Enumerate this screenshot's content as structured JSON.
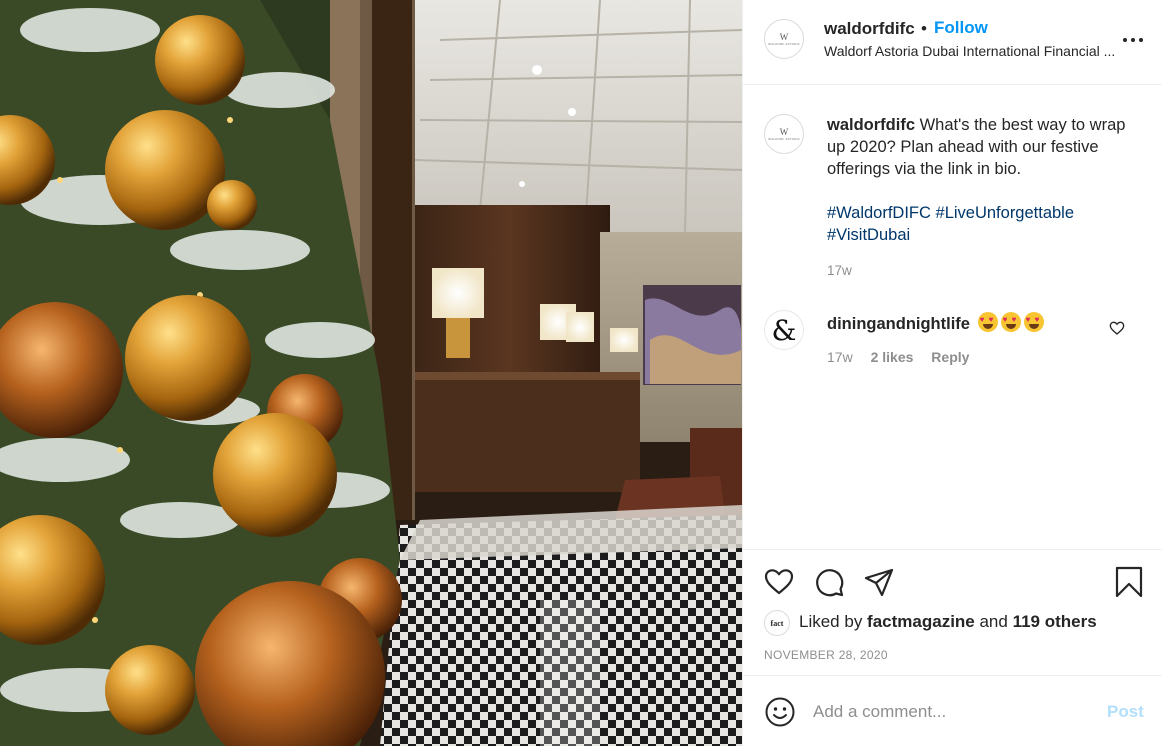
{
  "header": {
    "username": "waldorfdifc",
    "separator": "•",
    "follow_label": "Follow",
    "location": "Waldorf Astoria Dubai International Financial ..."
  },
  "avatar": {
    "mark": "W",
    "sub": "WALDORF ASTORIA"
  },
  "caption": {
    "username": "waldorfdifc",
    "text": " What's the best way to wrap up 2020? Plan ahead with our festive offerings via the link in bio.",
    "hashtags": [
      "#WaldorfDIFC",
      "#LiveUnforgettable",
      "#VisitDubai"
    ],
    "time": "17w"
  },
  "comment": {
    "avatar_glyph": "&",
    "username": "diningandnightlife",
    "emoji_name": "heart-eyes-emoji",
    "time": "17w",
    "likes": "2 likes",
    "reply_label": "Reply"
  },
  "likes": {
    "avatar_text": "fact",
    "prefix": "Liked by ",
    "user": "factmagazine",
    "middle": " and ",
    "others": "119 others"
  },
  "date": "NOVEMBER 28, 2020",
  "add_comment": {
    "placeholder": "Add a comment...",
    "post_label": "Post"
  },
  "colors": {
    "accent": "#0095f6",
    "hashtag": "#00376b",
    "muted": "#8e8e8e",
    "post_disabled": "#b2dffc"
  },
  "icons": {
    "like": "heart-icon",
    "comment": "comment-icon",
    "share": "paper-plane-icon",
    "save": "bookmark-icon",
    "more": "more-options-icon",
    "emoji": "smiley-icon"
  }
}
